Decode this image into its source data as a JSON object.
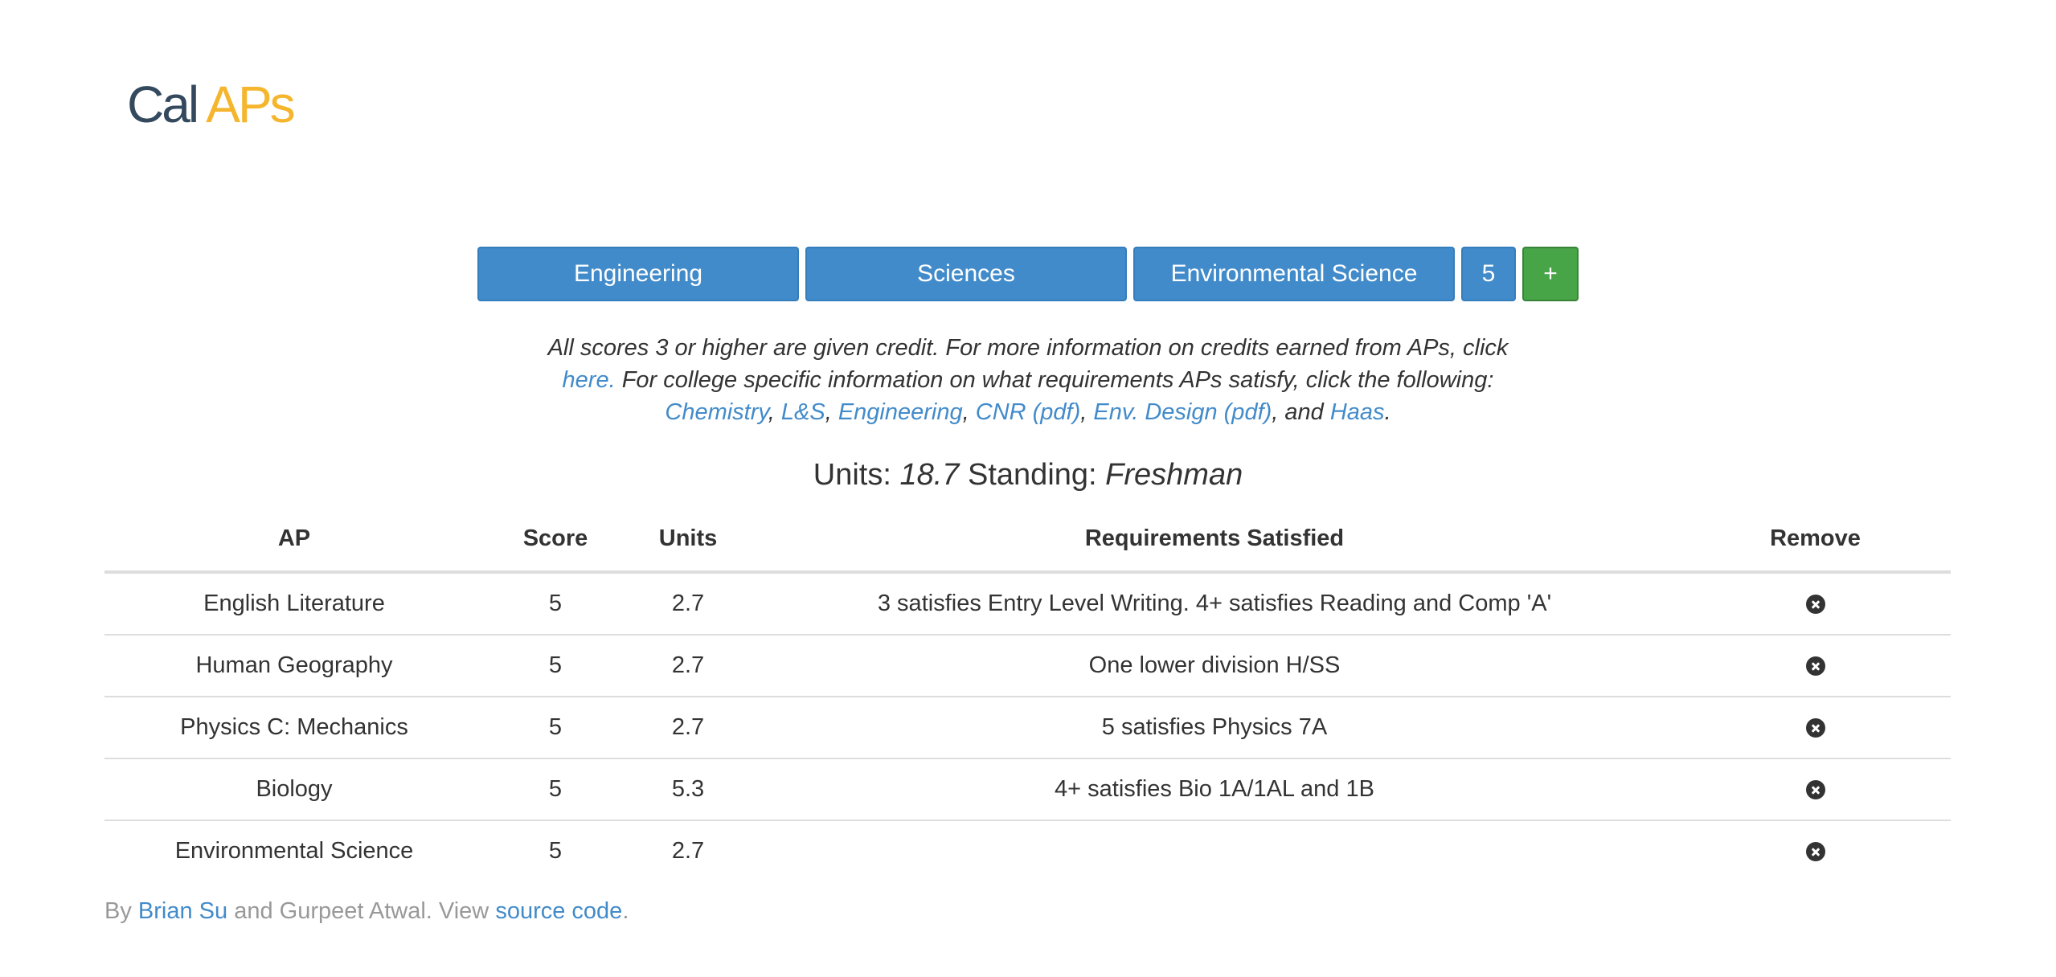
{
  "brand": {
    "part1": "Cal",
    "part2": "APs"
  },
  "colors": {
    "primary": "#428bca",
    "success": "#47a447",
    "brand_dark": "#34495e",
    "brand_accent": "#f5b52c"
  },
  "toolbar": {
    "select_1": "Engineering",
    "select_2": "Sciences",
    "select_3": "Environmental Science",
    "score": "5",
    "add_label": "+"
  },
  "info": {
    "text1": "All scores 3 or higher are given credit. For more information on credits earned from APs, click",
    "here_link": "here.",
    "text2": "For college specific information on what requirements APs satisfy, click the following:",
    "links": [
      "Chemistry",
      "L&S",
      "Engineering",
      "CNR (pdf)",
      "Env. Design (pdf)",
      "Haas"
    ],
    "and_text": "and"
  },
  "summary": {
    "units_label": "Units:",
    "units_value": "18.7",
    "standing_label": "Standing:",
    "standing_value": "Freshman"
  },
  "table": {
    "headers": [
      "AP",
      "Score",
      "Units",
      "Requirements Satisfied",
      "Remove"
    ],
    "rows": [
      {
        "ap": "English Literature",
        "score": "5",
        "units": "2.7",
        "req": "3 satisfies Entry Level Writing. 4+ satisfies Reading and Comp 'A'"
      },
      {
        "ap": "Human Geography",
        "score": "5",
        "units": "2.7",
        "req": "One lower division H/SS"
      },
      {
        "ap": "Physics C: Mechanics",
        "score": "5",
        "units": "2.7",
        "req": "5 satisfies Physics 7A"
      },
      {
        "ap": "Biology",
        "score": "5",
        "units": "5.3",
        "req": "4+ satisfies Bio 1A/1AL and 1B"
      },
      {
        "ap": "Environmental Science",
        "score": "5",
        "units": "2.7",
        "req": ""
      }
    ]
  },
  "footer": {
    "by": "By",
    "author1": "Brian Su",
    "and_text": "and Gurpeet Atwal. View",
    "source_link": "source code",
    "period": "."
  }
}
